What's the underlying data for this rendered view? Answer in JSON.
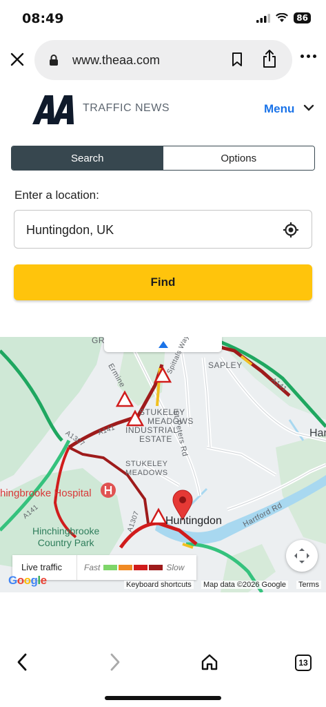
{
  "status_bar": {
    "time": "08:49",
    "battery": "86"
  },
  "browser": {
    "url": "www.theaa.com",
    "tab_count": "13"
  },
  "header": {
    "section_title": "TRAFFIC NEWS",
    "menu_label": "Menu"
  },
  "tabs": [
    {
      "label": "Search",
      "active": true
    },
    {
      "label": "Options",
      "active": false
    }
  ],
  "location": {
    "label": "Enter a location:",
    "value": "Huntingdon, UK"
  },
  "find_label": "Find",
  "map": {
    "labels": {
      "sapley": "SAPLEY",
      "stukeley_meadows_industrial": [
        "STUKELEY",
        "MEADOWS",
        "INDUSTRIAL",
        "ESTATE"
      ],
      "stukeley_meadows": [
        "STUKELEY",
        "MEADOWS"
      ],
      "hartford": "Hartfor",
      "hinchingbrooke_hospital": "hingbrooke Hospital",
      "hinchingbrooke_park": [
        "Hinchingbrooke",
        "Country Park"
      ],
      "huntingdon": "Huntingdon",
      "st_peters_rd": "St Peters Rd",
      "hartford_rd": "Hartford Rd",
      "ermine": "Ermine",
      "spittals": "Spittals Way",
      "a141_left": "A141",
      "a141_mid": "A141",
      "a141_right": "A141",
      "a1307_top": "A1307",
      "a1307_bottom": "A1307",
      "gr": "GR",
      "keyboard_shortcuts": "Keyboard shortcuts",
      "map_data": "Map data ©2026 Google",
      "terms": "Terms",
      "google": "Google"
    },
    "legend": {
      "title": "Live traffic",
      "fast": "Fast",
      "slow": "Slow",
      "colors": [
        "#7fd66a",
        "#f08a24",
        "#d01c1c",
        "#9e1b1b"
      ]
    }
  }
}
